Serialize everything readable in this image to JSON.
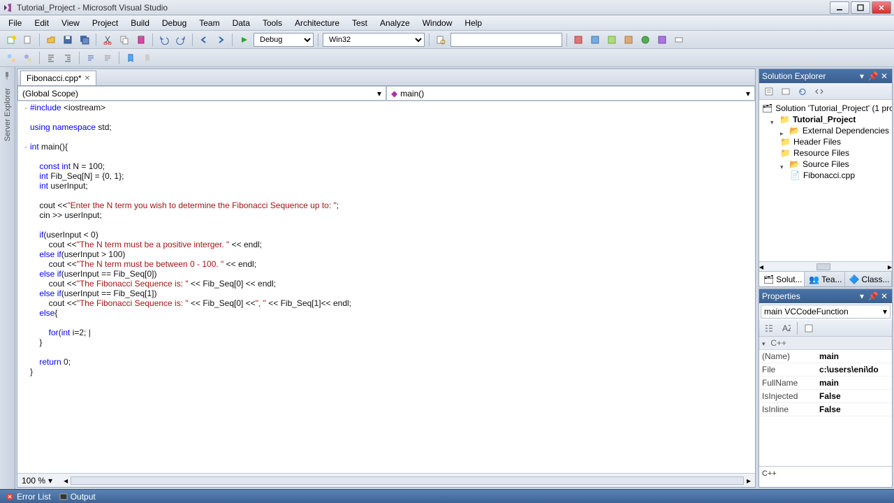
{
  "title": "Tutorial_Project - Microsoft Visual Studio",
  "menu": [
    "File",
    "Edit",
    "View",
    "Project",
    "Build",
    "Debug",
    "Team",
    "Data",
    "Tools",
    "Architecture",
    "Test",
    "Analyze",
    "Window",
    "Help"
  ],
  "toolbar1": {
    "config_select": "Debug",
    "platform_select": "Win32",
    "find_value": ""
  },
  "leftStrip": {
    "tab1": "Server Explorer"
  },
  "doc": {
    "tab_label": "Fibonacci.cpp*",
    "nav_scope": "(Global Scope)",
    "nav_func": "main()",
    "zoom": "100 %"
  },
  "code_lines": [
    {
      "g": "-",
      "t": [
        {
          "s": "kw",
          "x": "#include"
        },
        {
          "x": " <iostream>"
        }
      ]
    },
    {
      "t": []
    },
    {
      "t": [
        {
          "s": "kw",
          "x": "using"
        },
        {
          "x": " "
        },
        {
          "s": "kw",
          "x": "namespace"
        },
        {
          "x": " std;"
        }
      ]
    },
    {
      "t": []
    },
    {
      "g": "-",
      "t": [
        {
          "s": "kw",
          "x": "int"
        },
        {
          "x": " main(){"
        }
      ]
    },
    {
      "t": []
    },
    {
      "t": [
        {
          "x": "    "
        },
        {
          "s": "kw",
          "x": "const"
        },
        {
          "x": " "
        },
        {
          "s": "kw",
          "x": "int"
        },
        {
          "x": " N = 100;"
        }
      ]
    },
    {
      "t": [
        {
          "x": "    "
        },
        {
          "s": "kw",
          "x": "int"
        },
        {
          "x": " Fib_Seq[N] = {0, 1};"
        }
      ]
    },
    {
      "t": [
        {
          "x": "    "
        },
        {
          "s": "kw",
          "x": "int"
        },
        {
          "x": " userInput;"
        }
      ]
    },
    {
      "t": []
    },
    {
      "t": [
        {
          "x": "    cout <<"
        },
        {
          "s": "str",
          "x": "\"Enter the N term you wish to determine the Fibonacci Sequence up to: \""
        },
        {
          "x": ";"
        }
      ]
    },
    {
      "t": [
        {
          "x": "    cin >> userInput;"
        }
      ]
    },
    {
      "t": []
    },
    {
      "t": [
        {
          "x": "    "
        },
        {
          "s": "kw",
          "x": "if"
        },
        {
          "x": "(userInput < 0)"
        }
      ]
    },
    {
      "t": [
        {
          "x": "        cout <<"
        },
        {
          "s": "str",
          "x": "\"The N term must be a positive interger. \""
        },
        {
          "x": " << endl;"
        }
      ]
    },
    {
      "t": [
        {
          "x": "    "
        },
        {
          "s": "kw",
          "x": "else"
        },
        {
          "x": " "
        },
        {
          "s": "kw",
          "x": "if"
        },
        {
          "x": "(userInput > 100)"
        }
      ]
    },
    {
      "t": [
        {
          "x": "        cout <<"
        },
        {
          "s": "str",
          "x": "\"The N term must be between 0 - 100. \""
        },
        {
          "x": " << endl;"
        }
      ]
    },
    {
      "t": [
        {
          "x": "    "
        },
        {
          "s": "kw",
          "x": "else"
        },
        {
          "x": " "
        },
        {
          "s": "kw",
          "x": "if"
        },
        {
          "x": "(userInput == Fib_Seq[0])"
        }
      ]
    },
    {
      "t": [
        {
          "x": "        cout <<"
        },
        {
          "s": "str",
          "x": "\"The Fibonacci Sequence is: \""
        },
        {
          "x": " << Fib_Seq[0] << endl;"
        }
      ]
    },
    {
      "t": [
        {
          "x": "    "
        },
        {
          "s": "kw",
          "x": "else"
        },
        {
          "x": " "
        },
        {
          "s": "kw",
          "x": "if"
        },
        {
          "x": "(userInput == Fib_Seq[1])"
        }
      ]
    },
    {
      "t": [
        {
          "x": "        cout <<"
        },
        {
          "s": "str",
          "x": "\"The Fibonacci Sequence is: \""
        },
        {
          "x": " << Fib_Seq[0] <<"
        },
        {
          "s": "str",
          "x": "\", \""
        },
        {
          "x": " << Fib_Seq[1]<< endl;"
        }
      ]
    },
    {
      "t": [
        {
          "x": "    "
        },
        {
          "s": "kw",
          "x": "else"
        },
        {
          "x": "{"
        }
      ]
    },
    {
      "t": []
    },
    {
      "t": [
        {
          "x": "        "
        },
        {
          "s": "kw",
          "x": "for"
        },
        {
          "x": "("
        },
        {
          "s": "kw",
          "x": "int"
        },
        {
          "x": " i=2; |"
        }
      ]
    },
    {
      "t": [
        {
          "x": "    }"
        }
      ]
    },
    {
      "t": []
    },
    {
      "t": [
        {
          "x": "    "
        },
        {
          "s": "kw",
          "x": "return"
        },
        {
          "x": " 0;"
        }
      ]
    },
    {
      "t": [
        {
          "x": "}"
        }
      ]
    }
  ],
  "solExp": {
    "title": "Solution Explorer",
    "solution": "Solution 'Tutorial_Project' (1 proj",
    "project": "Tutorial_Project",
    "folders": [
      "External Dependencies",
      "Header Files",
      "Resource Files",
      "Source Files"
    ],
    "file": "Fibonacci.cpp",
    "tabs": [
      "Solut...",
      "Tea...",
      "Class..."
    ]
  },
  "props": {
    "title": "Properties",
    "selector": "main VCCodeFunction",
    "category": "C++",
    "rows": [
      {
        "k": "(Name)",
        "v": "main"
      },
      {
        "k": "File",
        "v": "c:\\users\\eni\\do"
      },
      {
        "k": "FullName",
        "v": "main"
      },
      {
        "k": "IsInjected",
        "v": "False"
      },
      {
        "k": "IsInline",
        "v": "False"
      }
    ],
    "desc": "C++"
  },
  "status": {
    "errorlist": "Error List",
    "output": "Output"
  }
}
